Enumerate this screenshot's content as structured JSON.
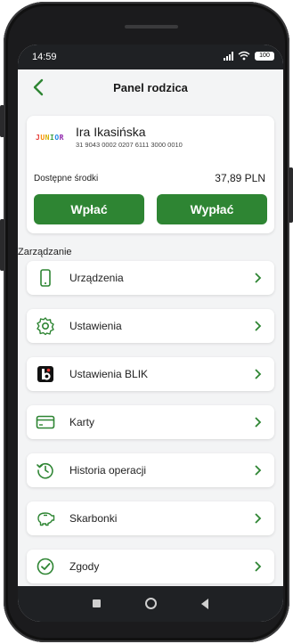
{
  "status_bar": {
    "time": "14:59",
    "battery": "100"
  },
  "header": {
    "title": "Panel rodzica"
  },
  "account": {
    "logo_letters": [
      "J",
      "U",
      "N",
      "I",
      "O",
      "R"
    ],
    "logo_colors": [
      "#e53935",
      "#fb8c00",
      "#fdd835",
      "#43a047",
      "#1e88e5",
      "#8e24aa"
    ],
    "owner_name": "Ira Ikasińska",
    "account_number": "31 9043 0002 0207 6111 3000 0010",
    "funds_label": "Dostępne środki",
    "funds_value": "37,89 PLN",
    "deposit_label": "Wpłać",
    "withdraw_label": "Wypłać"
  },
  "section_label": "Zarządzanie",
  "menu": [
    {
      "label": "Urządzenia",
      "icon": "phone-icon"
    },
    {
      "label": "Ustawienia",
      "icon": "gear-icon"
    },
    {
      "label": "Ustawienia BLIK",
      "icon": "blik-icon"
    },
    {
      "label": "Karty",
      "icon": "card-icon"
    },
    {
      "label": "Historia operacji",
      "icon": "history-icon"
    },
    {
      "label": "Skarbonki",
      "icon": "piggy-bank-icon"
    },
    {
      "label": "Zgody",
      "icon": "check-circle-icon"
    }
  ],
  "colors": {
    "accent_green": "#2e8533",
    "background": "#f3f4f5"
  }
}
